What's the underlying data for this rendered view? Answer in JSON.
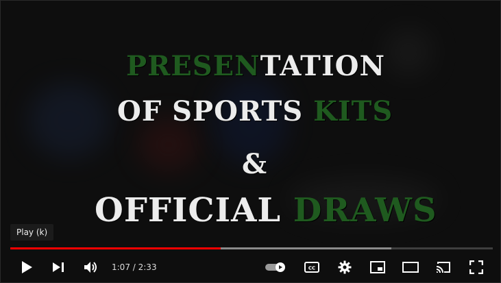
{
  "video": {
    "title_lines": {
      "l1_green": "PRESEN",
      "l1_white": "TATION",
      "l2_white": "OF SPORTS ",
      "l2_green": "KITS",
      "l3": "&",
      "l4_white": "OFFICIAL ",
      "l4_green": "DRAWS"
    }
  },
  "tooltip": "Play (k)",
  "controls": {
    "current_time": "1:07",
    "duration": "2:33",
    "progress_fraction": 0.436,
    "buffered_fraction": 0.79,
    "icons": [
      "play-icon",
      "next-icon",
      "volume-icon",
      "autoplay-toggle-icon",
      "captions-icon",
      "settings-icon",
      "miniplayer-icon",
      "theater-icon",
      "cast-icon",
      "fullscreen-icon"
    ]
  },
  "colors": {
    "accent": "#ff0000",
    "title_green": "#1f5a1f",
    "title_white": "#ececec"
  }
}
